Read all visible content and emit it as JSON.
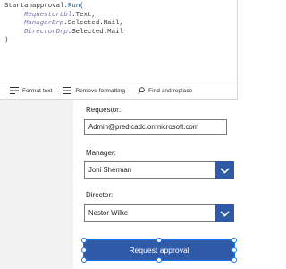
{
  "formula": {
    "line1_fn": "Startanapproval",
    "line1_run": ".Run(",
    "line2_ref": "RequestorLbl",
    "line2_prop": ".Text,",
    "line3_ref": "ManagerDrp",
    "line3_prop": ".Selected.Mail,",
    "line4_ref": "DirectorDrp",
    "line4_prop": ".Selected.Mail",
    "line5": ")"
  },
  "format_bar": {
    "format_text": "Format text",
    "remove_formatting": "Remove formatting",
    "find_replace": "Find and replace"
  },
  "form": {
    "requestor_label": "Requestor:",
    "requestor_value": "Admin@predicadc.onmicrosoft.com",
    "manager_label": "Manager:",
    "manager_value": "Joni Sherman",
    "director_label": "Director:",
    "director_value": "Nestor Wilke",
    "submit_label": "Request approval"
  },
  "colors": {
    "accent": "#2f5aa8",
    "selection": "#1a73e8"
  }
}
